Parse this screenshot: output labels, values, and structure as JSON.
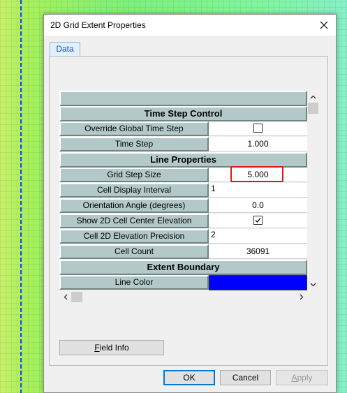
{
  "dialog": {
    "title": "2D Grid Extent Properties",
    "close_icon": "close-icon"
  },
  "tabs": [
    {
      "label": "Data",
      "selected": true
    }
  ],
  "grid": {
    "header_blank": "",
    "sections": [
      {
        "title": "Time Step Control",
        "rows": [
          {
            "label": "Override Global Time Step",
            "type": "checkbox",
            "checked": false
          },
          {
            "label": "Time Step",
            "value": "1.000"
          }
        ]
      },
      {
        "title": "Line Properties",
        "rows": [
          {
            "label": "Grid Step Size",
            "value": "5.000",
            "highlighted": true
          },
          {
            "label": "Cell Display Interval",
            "value": "1"
          },
          {
            "label": "Orientation Angle (degrees)",
            "value": "0.0"
          },
          {
            "label": "Show 2D Cell Center Elevation",
            "type": "checkbox",
            "checked": true
          },
          {
            "label": "Cell 2D Elevation Precision",
            "value": "2"
          },
          {
            "label": "Cell Count",
            "value": "36091"
          }
        ]
      },
      {
        "title": "Extent Boundary",
        "rows": [
          {
            "label": "Line Color",
            "type": "color",
            "color": "#0000ff"
          }
        ]
      }
    ]
  },
  "buttons": {
    "field_info_prefix": "F",
    "field_info_rest": "ield Info",
    "ok": "OK",
    "cancel": "Cancel",
    "apply_prefix": "A",
    "apply_rest": "pply",
    "apply_enabled": false
  },
  "colors": {
    "grid_label_bg": "#b3c9c9",
    "highlight": "#e0161a",
    "line_color": "#0000ff",
    "tab_text": "#1f4fb5"
  }
}
